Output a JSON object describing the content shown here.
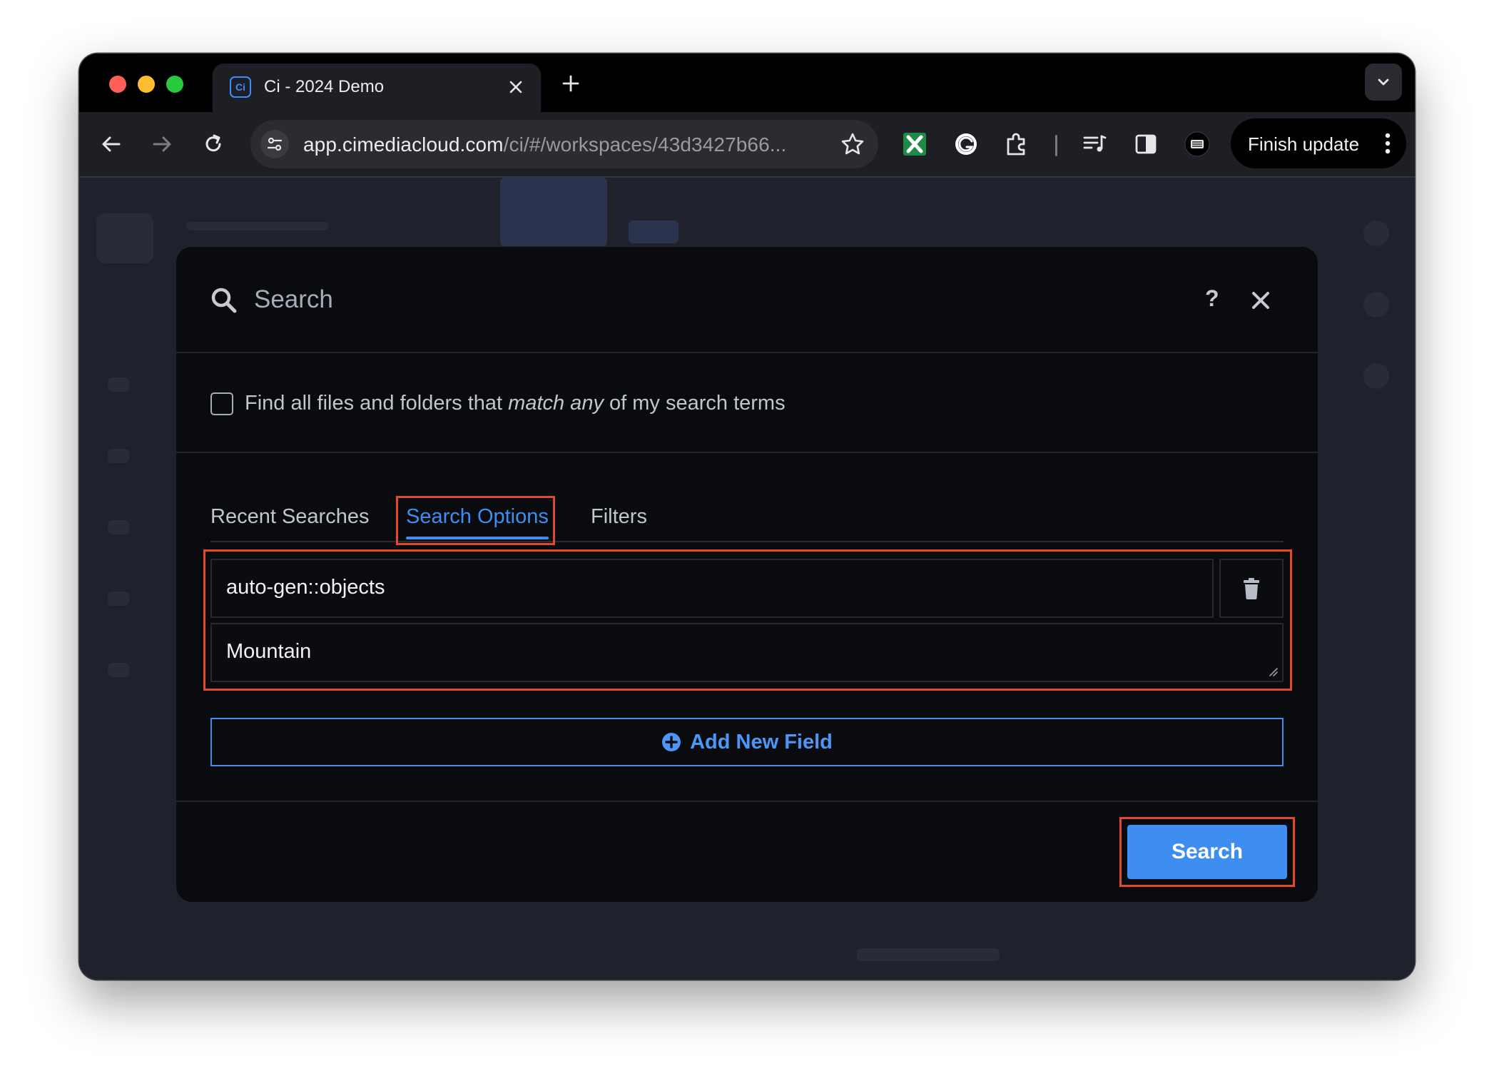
{
  "browser": {
    "tab_title": "Ci - 2024 Demo",
    "tab_favicon": "Ci",
    "url_host": "app.cimediacloud.com",
    "url_path": "/ci/#/workspaces/43d3427b66...",
    "finish_update_label": "Finish update"
  },
  "modal": {
    "title": "Search",
    "help_label": "?",
    "match_any": {
      "prefix": "Find all files and folders that ",
      "emphasis": "match any",
      "suffix": " of my search terms",
      "checked": false
    },
    "tabs": [
      {
        "label": "Recent Searches",
        "active": false
      },
      {
        "label": "Search Options",
        "active": true
      },
      {
        "label": "Filters",
        "active": false
      }
    ],
    "field_key": "auto-gen::objects",
    "field_value": "Mountain",
    "add_field_label": "Add New Field",
    "search_button_label": "Search"
  },
  "colors": {
    "accent": "#3d8ef0",
    "highlight": "#e5482a",
    "modal_bg": "#0a0b0e"
  }
}
